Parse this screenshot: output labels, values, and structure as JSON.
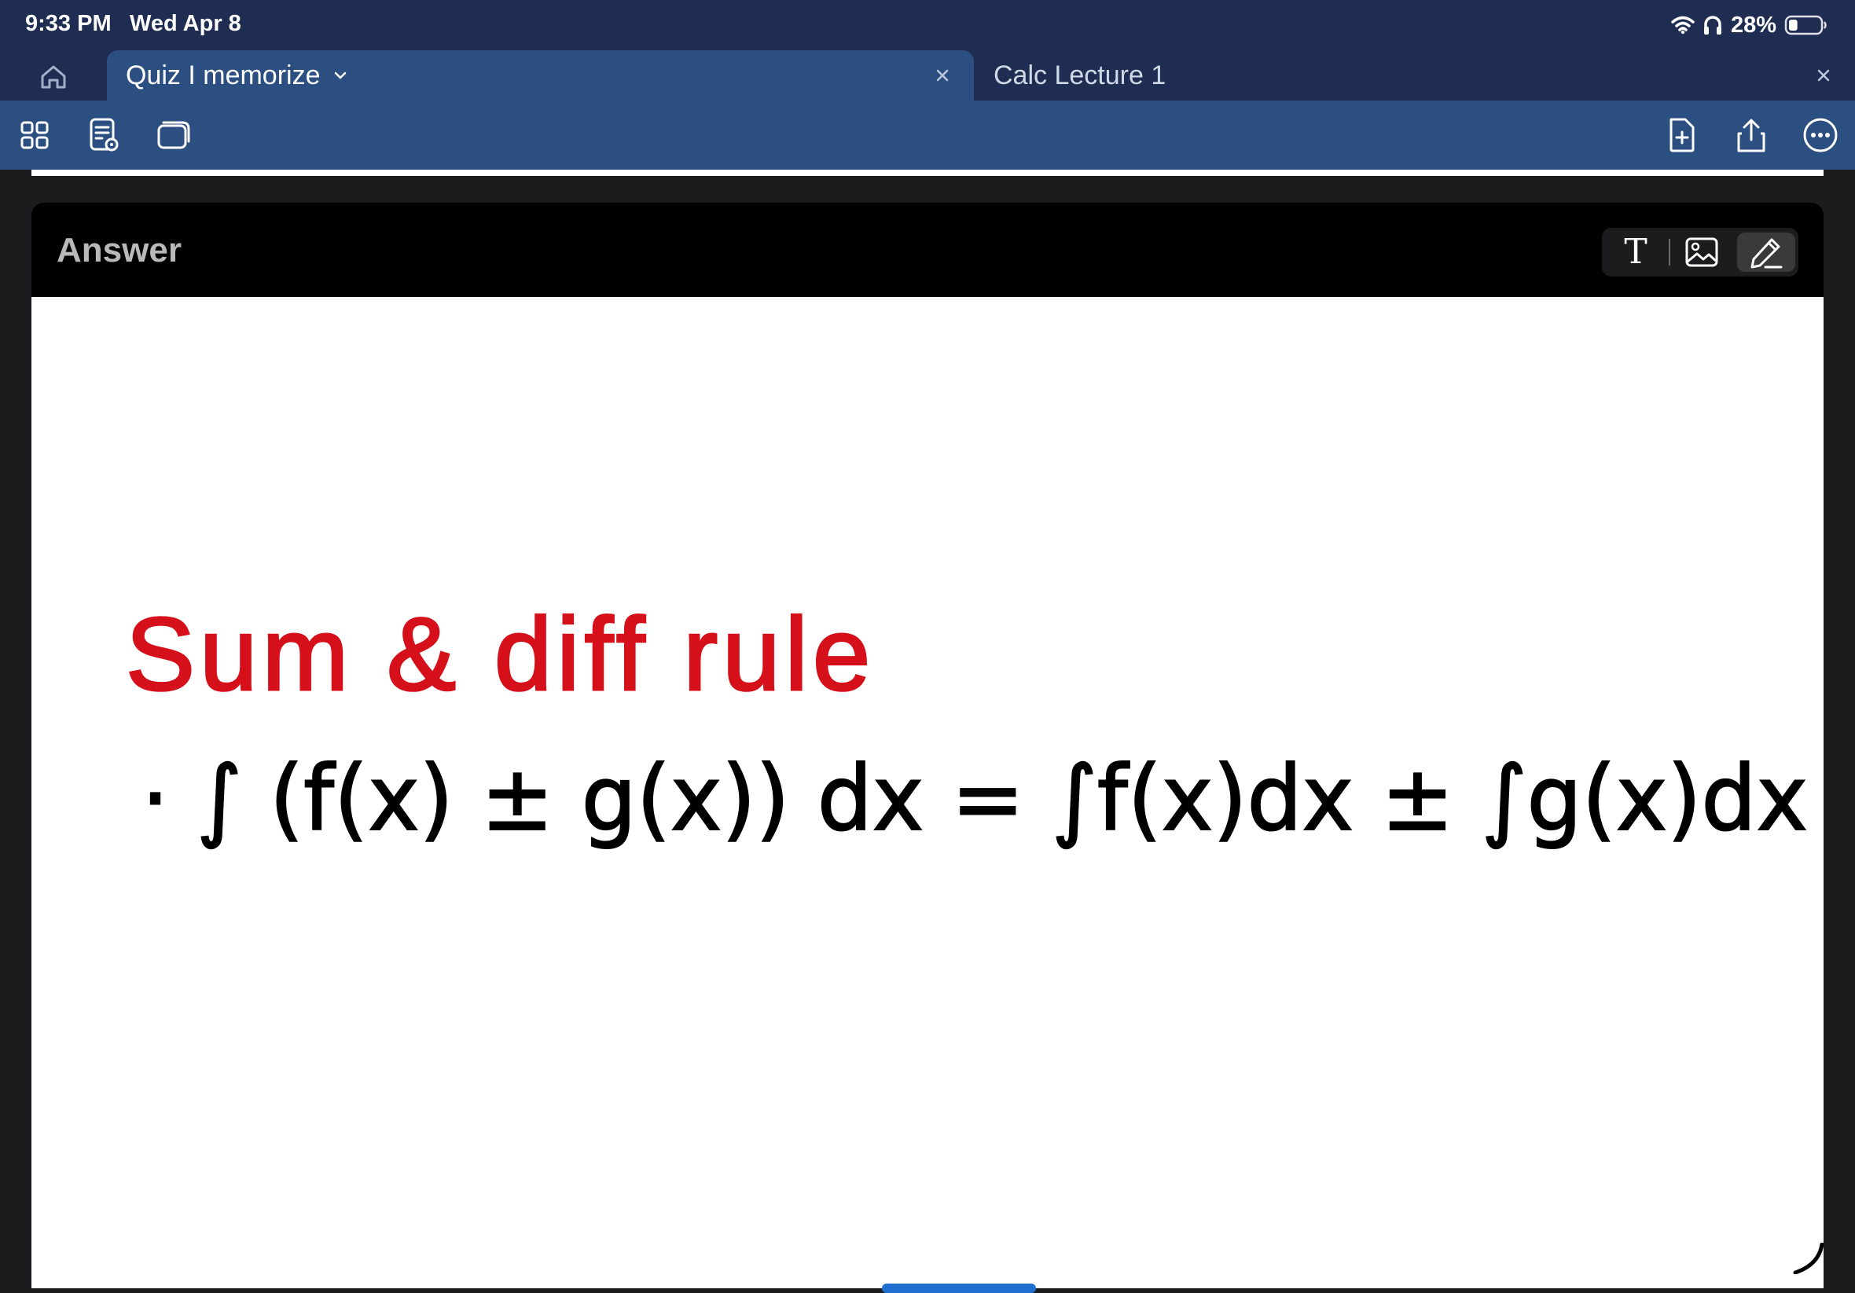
{
  "status_bar": {
    "time": "9:33 PM",
    "date": "Wed Apr 8",
    "battery_percent": "28%",
    "battery_level": 0.28,
    "icons": [
      "wifi-icon",
      "headphones-icon",
      "battery-icon"
    ]
  },
  "tabs": [
    {
      "label": "Quiz I memorize",
      "active": true
    },
    {
      "label": "Calc Lecture 1",
      "active": false
    }
  ],
  "toolbar": {
    "left_icons": [
      "grid-view-icon",
      "document-preview-icon",
      "cards-icon"
    ],
    "right_icons": [
      "add-page-icon",
      "share-icon",
      "more-icon"
    ]
  },
  "card": {
    "title": "Answer",
    "input_modes": [
      "text",
      "image",
      "pen"
    ],
    "text_mode_glyph": "T",
    "selected_mode": "pen"
  },
  "handwriting": {
    "heading": "Sum & diff rule",
    "formula": "· ∫ (f(x) ± g(x)) dx = ∫f(x)dx ± ∫g(x)dx",
    "heading_color": "#d5101a",
    "formula_color": "#000000"
  }
}
